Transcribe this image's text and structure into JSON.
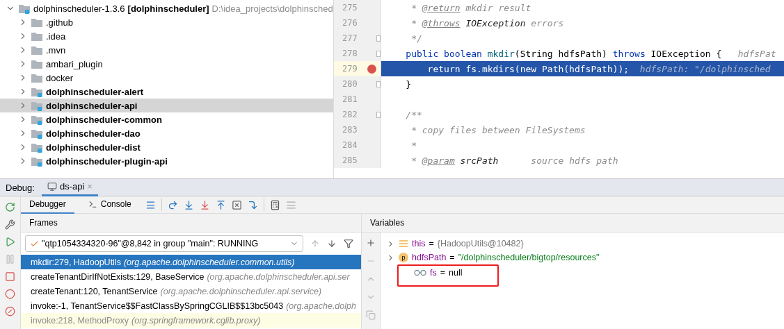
{
  "project_tree": {
    "root": {
      "name": "dolphinscheduler-1.3.6",
      "module": "[dolphinscheduler]",
      "path": "D:\\idea_projects\\dolphinsched",
      "expanded": true
    },
    "children": [
      {
        "label": ".github",
        "kind": "folder",
        "selected": false
      },
      {
        "label": ".idea",
        "kind": "folder",
        "selected": false
      },
      {
        "label": ".mvn",
        "kind": "folder",
        "selected": false
      },
      {
        "label": "ambari_plugin",
        "kind": "folder",
        "selected": false
      },
      {
        "label": "docker",
        "kind": "folder",
        "selected": false
      },
      {
        "label": "dolphinscheduler-alert",
        "kind": "module",
        "selected": false
      },
      {
        "label": "dolphinscheduler-api",
        "kind": "module",
        "selected": true
      },
      {
        "label": "dolphinscheduler-common",
        "kind": "module",
        "selected": false
      },
      {
        "label": "dolphinscheduler-dao",
        "kind": "module",
        "selected": false
      },
      {
        "label": "dolphinscheduler-dist",
        "kind": "module",
        "selected": false
      },
      {
        "label": "dolphinscheduler-plugin-api",
        "kind": "module",
        "selected": false
      }
    ]
  },
  "editor": {
    "lines": [
      {
        "number": "275",
        "fold": false,
        "current": false,
        "breakpoint": false,
        "segments": [
          {
            "text": "     * ",
            "kind": "comment"
          },
          {
            "text": "@return",
            "kind": "tag"
          },
          {
            "text": " mkdir result",
            "kind": "comment"
          }
        ]
      },
      {
        "number": "276",
        "fold": false,
        "current": false,
        "breakpoint": false,
        "segments": [
          {
            "text": "     * ",
            "kind": "comment"
          },
          {
            "text": "@throws",
            "kind": "tag"
          },
          {
            "text": " IOException",
            "kind": "docref"
          },
          {
            "text": " errors",
            "kind": "comment"
          }
        ]
      },
      {
        "number": "277",
        "fold": true,
        "current": false,
        "breakpoint": false,
        "segments": [
          {
            "text": "     */",
            "kind": "comment"
          }
        ]
      },
      {
        "number": "278",
        "fold": true,
        "current": false,
        "breakpoint": false,
        "segments": [
          {
            "text": "    public boolean",
            "kind": "keyword"
          },
          {
            "text": " mkdir",
            "kind": "method"
          },
          {
            "text": "(String hdfsPath) ",
            "kind": "plain"
          },
          {
            "text": "throws",
            "kind": "keyword"
          },
          {
            "text": " IOException {",
            "kind": "plain"
          },
          {
            "text": "   hdfsPat",
            "kind": "hint"
          }
        ]
      },
      {
        "number": "279",
        "fold": false,
        "current": true,
        "breakpoint": true,
        "segments": [
          {
            "text": "        return fs.mkdirs(new Path(hdfsPath));",
            "kind": "plain"
          },
          {
            "text": "  hdfsPath: \"/dolphinsched",
            "kind": "hint"
          }
        ]
      },
      {
        "number": "280",
        "fold": true,
        "current": false,
        "breakpoint": false,
        "segments": [
          {
            "text": "    }",
            "kind": "plain"
          }
        ]
      },
      {
        "number": "281",
        "fold": false,
        "current": false,
        "breakpoint": false
      },
      {
        "number": "282",
        "fold": true,
        "current": false,
        "breakpoint": false,
        "segments": [
          {
            "text": "    /**",
            "kind": "comment"
          }
        ]
      },
      {
        "number": "283",
        "fold": false,
        "current": false,
        "breakpoint": false,
        "segments": [
          {
            "text": "     * copy files between FileSystems",
            "kind": "comment"
          }
        ]
      },
      {
        "number": "284",
        "fold": false,
        "current": false,
        "breakpoint": false,
        "segments": [
          {
            "text": "     *",
            "kind": "comment"
          }
        ]
      },
      {
        "number": "285",
        "fold": false,
        "current": false,
        "breakpoint": false,
        "segments": [
          {
            "text": "     * ",
            "kind": "comment"
          },
          {
            "text": "@param",
            "kind": "tag"
          },
          {
            "text": " srcPath",
            "kind": "docref"
          },
          {
            "text": "      source hdfs path",
            "kind": "comment"
          }
        ]
      }
    ]
  },
  "debug": {
    "label": "Debug:",
    "session_tab": {
      "label": "ds-api",
      "close": "×",
      "selected": true
    },
    "tabs": [
      {
        "label": "Debugger",
        "selected": true
      },
      {
        "label": "Console",
        "selected": false
      }
    ],
    "frames": {
      "title": "Frames",
      "thread": "\"qtp1054334320-96\"@8,842 in group \"main\": RUNNING",
      "items": [
        {
          "method": "mkdir:279, HadoopUtils",
          "package": "(org.apache.dolphinscheduler.common.utils)",
          "selected": true,
          "library": false
        },
        {
          "method": "createTenantDirIfNotExists:129, BaseService",
          "package": "(org.apache.dolphinscheduler.api.ser",
          "selected": false,
          "library": false
        },
        {
          "method": "createTenant:120, TenantService",
          "package": "(org.apache.dolphinscheduler.api.service)",
          "selected": false,
          "library": false
        },
        {
          "method": "invoke:-1, TenantService$$FastClassBySpringCGLIB$$13bc5043",
          "package": "(org.apache.dolph",
          "selected": false,
          "library": false
        },
        {
          "method": "invoke:218, MethodProxy",
          "package": "(org.springframework.cglib.proxy)",
          "selected": false,
          "library": true
        }
      ]
    },
    "variables": {
      "title": "Variables",
      "items": [
        {
          "name": "this",
          "equals": "=",
          "value": "{HadoopUtils@10482}",
          "kind": "object",
          "expandable": true,
          "highlighted": false
        },
        {
          "name": "hdfsPath",
          "badge": "p",
          "equals": "=",
          "value": "\"/dolphinscheduler/bigtop/resources\"",
          "kind": "param",
          "expandable": true,
          "highlighted": false
        },
        {
          "name": "fs",
          "equals": "=",
          "value": "null",
          "kind": "watch",
          "expandable": false,
          "highlighted": true
        }
      ]
    }
  }
}
